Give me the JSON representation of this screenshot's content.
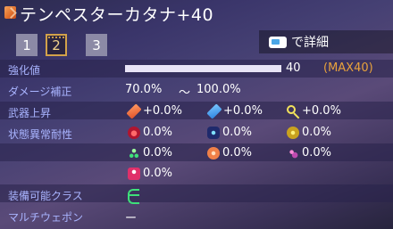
{
  "header": {
    "title": "テンペスターカタナ+40",
    "tabs": [
      {
        "label": "1",
        "active": false
      },
      {
        "label": "2",
        "active": true
      },
      {
        "label": "3",
        "active": false
      }
    ],
    "detail_button": {
      "label": "で詳細",
      "icon": "controller-button-icon"
    }
  },
  "stats": {
    "enhancement": {
      "label": "強化値",
      "value": "40",
      "max": "(MAX40)",
      "fraction": 1.0
    },
    "damage_correction": {
      "label": "ダメージ補正",
      "min": "70.0%",
      "separator": "〜",
      "max": "100.0%"
    },
    "weapon_boost": {
      "label": "武器上昇",
      "items": [
        {
          "icon": "sword-orange-icon",
          "value": "+0.0%"
        },
        {
          "icon": "sword-blue-icon",
          "value": "+0.0%"
        },
        {
          "icon": "key-yellow-icon",
          "value": "+0.0%"
        }
      ]
    },
    "status_resist": {
      "label": "状態異常耐性",
      "items": [
        {
          "icon": "poison-icon",
          "value": "0.0%"
        },
        {
          "icon": "burn-icon",
          "value": "0.0%"
        },
        {
          "icon": "shock-icon",
          "value": "0.0%"
        },
        {
          "icon": "freeze-icon",
          "value": "0.0%"
        },
        {
          "icon": "panic-icon",
          "value": "0.0%"
        },
        {
          "icon": "mirage-icon",
          "value": "0.0%"
        },
        {
          "icon": "pull-icon",
          "value": "0.0%"
        }
      ]
    },
    "equip_class": {
      "label": "装備可能クラス",
      "icon": "class-emblem-icon"
    },
    "multi_weapon": {
      "label": "マルチウェポン",
      "value": "ー"
    }
  },
  "colors": {
    "label": "#a9b4ff",
    "max_text": "#e8a23c",
    "accent_gold": "#d2a24a",
    "class_green": "#3ee07a"
  }
}
